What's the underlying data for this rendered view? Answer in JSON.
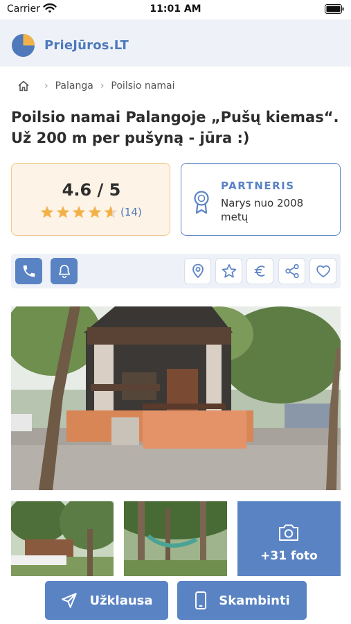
{
  "status_bar": {
    "carrier": "Carrier",
    "time": "11:01 AM"
  },
  "header": {
    "brand": "PrieJūros.LT"
  },
  "breadcrumb": {
    "items": [
      "Palanga",
      "Poilsio namai"
    ]
  },
  "listing": {
    "title": "Poilsio namai Palangoje „Pušų kiemas“. Už 200 m per pušyną - jūra :)"
  },
  "rating": {
    "value": "4.6 / 5",
    "score": 4.6,
    "max": 5,
    "count": "(14)"
  },
  "partner": {
    "title": "PARTNERIS",
    "subtitle": "Narys nuo 2008 metų"
  },
  "actions": {
    "left": [
      "phone-icon",
      "bell-icon"
    ],
    "right": [
      "location-icon",
      "star-icon",
      "euro-icon",
      "share-icon",
      "heart-icon"
    ]
  },
  "gallery": {
    "more_label": "+31 foto"
  },
  "bottom_buttons": {
    "inquiry": "Užklausa",
    "call": "Skambinti"
  },
  "colors": {
    "accent": "#5a83c4",
    "star": "#f2b24a",
    "rating_bg": "#fdf3e6",
    "header_bg": "#eef2f8"
  }
}
